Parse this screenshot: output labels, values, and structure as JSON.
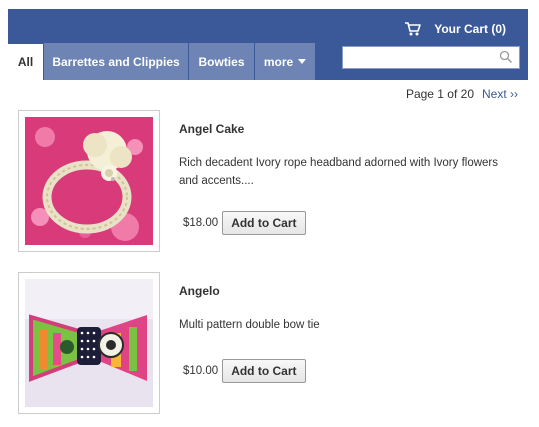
{
  "header": {
    "cart_label": "Your Cart (0)",
    "cart_icon": "shopping-cart-icon"
  },
  "tabs": [
    {
      "label": "All",
      "active": true
    },
    {
      "label": "Barrettes and Clippies",
      "active": false
    },
    {
      "label": "Bowties",
      "active": false
    },
    {
      "label": "more",
      "active": false
    }
  ],
  "search": {
    "value": "",
    "placeholder": "",
    "icon": "search-icon"
  },
  "pager": {
    "text": "Page 1 of 20",
    "next_label": "Next ››"
  },
  "products": [
    {
      "title": "Angel Cake",
      "description": "Rich decadent Ivory rope headband adorned with Ivory flowers and accents....",
      "price": "$18.00",
      "button_label": "Add to Cart"
    },
    {
      "title": "Angelo",
      "description": "Multi pattern double bow tie",
      "price": "$10.00",
      "button_label": "Add to Cart"
    }
  ],
  "colors": {
    "brand": "#3b5998",
    "tab_bg": "#6d84b4"
  }
}
